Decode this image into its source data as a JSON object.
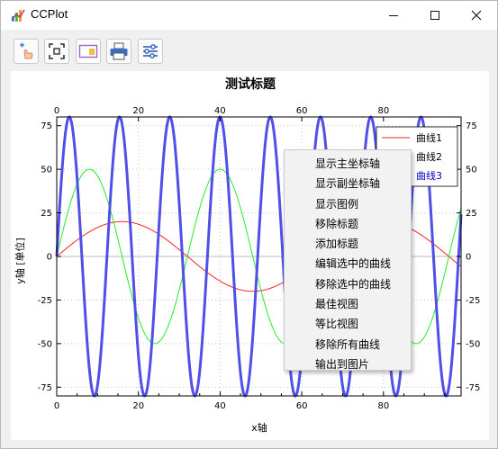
{
  "window": {
    "title": "CCPlot"
  },
  "toolbar": {
    "buttons": [
      "pointer-tool-icon",
      "zoom-fit-icon",
      "view-panel-icon",
      "printer-icon",
      "settings-sliders-icon"
    ]
  },
  "chart_data": {
    "type": "line",
    "title": "测试标题",
    "xlabel": "x轴",
    "ylabel": "y轴 [单位]",
    "xlim": [
      0,
      99
    ],
    "ylim": [
      -80,
      80
    ],
    "x_ticks": [
      "0",
      "20",
      "40",
      "60",
      "80"
    ],
    "x_tick_values": [
      0,
      20,
      40,
      60,
      80
    ],
    "y_ticks": [
      "75",
      "50",
      "25",
      "0",
      "-25",
      "-50",
      "-75"
    ],
    "y_tick_values": [
      75,
      50,
      25,
      0,
      -25,
      -50,
      -75
    ],
    "grid": true,
    "legend_position": "top-right",
    "series": [
      {
        "name": "曲线1",
        "color": "#ff2020",
        "amplitude": 20,
        "period": 64,
        "x_range": [
          0,
          99
        ]
      },
      {
        "name": "曲线2",
        "color": "#22ee22",
        "amplitude": 50,
        "period": 32,
        "x_range": [
          0,
          99
        ]
      },
      {
        "name": "曲线3",
        "color": "#5050e8",
        "amplitude": 80,
        "period": 12.3,
        "x_range": [
          0,
          99
        ],
        "selected": true
      }
    ]
  },
  "context_menu": {
    "items": [
      "显示主坐标轴",
      "显示副坐标轴",
      "显示图例",
      "移除标题",
      "添加标题",
      "编辑选中的曲线",
      "移除选中的曲线",
      "最佳视图",
      "等比视图",
      "移除所有曲线",
      "输出到图片"
    ]
  }
}
